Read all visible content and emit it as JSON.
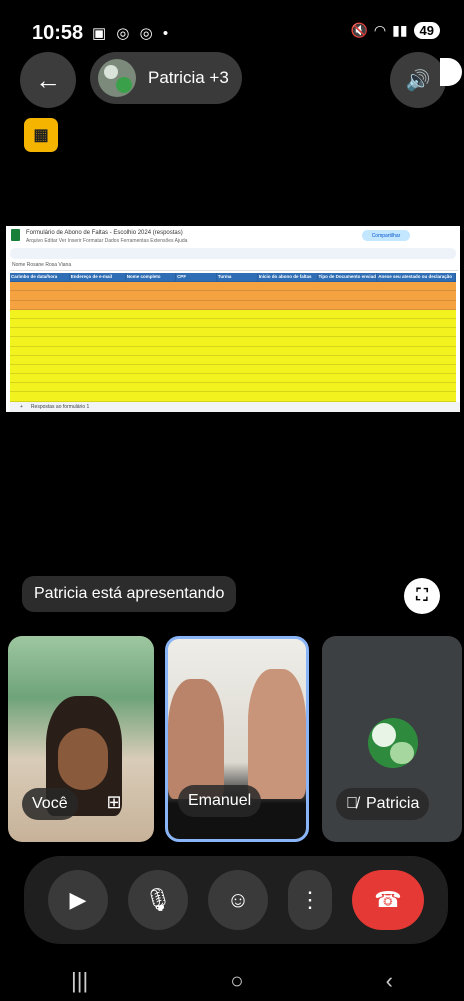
{
  "status_bar": {
    "time": "10:58",
    "left_icons": [
      "linkedin-icon",
      "whatsapp-icon",
      "whatsapp-business-icon",
      "dot-icon"
    ],
    "battery": "49"
  },
  "header": {
    "participants_label": "Patricia +3"
  },
  "sheet": {
    "title": "Formulário de Abono de Faltas - Escolhio 2024 (respostas)",
    "menu": "Arquivo  Editar  Ver  Inserir  Formatar  Dados  Ferramentas  Extensões  Ajuda",
    "share_label": "Compartilhar",
    "formula": "Nome Rosane Rosa Viana",
    "tab_label": "Respostas ao formulário 1",
    "header_row": [
      "Carimbo de data/hora",
      "Endereço de e-mail",
      "Nome completo",
      "CPF",
      "Turma",
      "Início do abono de faltas",
      "Tipo de Documento enviado",
      "Anexe seu atestado ou declaração"
    ]
  },
  "presenting_text": "Patricia está apresentando",
  "tiles": {
    "you_label": "Você",
    "emanuel_label": "Emanuel",
    "patricia_label": "Patricia"
  },
  "colors": {
    "end_call": "#e53935",
    "active_border": "#8ab4f8",
    "share_badge": "#f4b400"
  }
}
